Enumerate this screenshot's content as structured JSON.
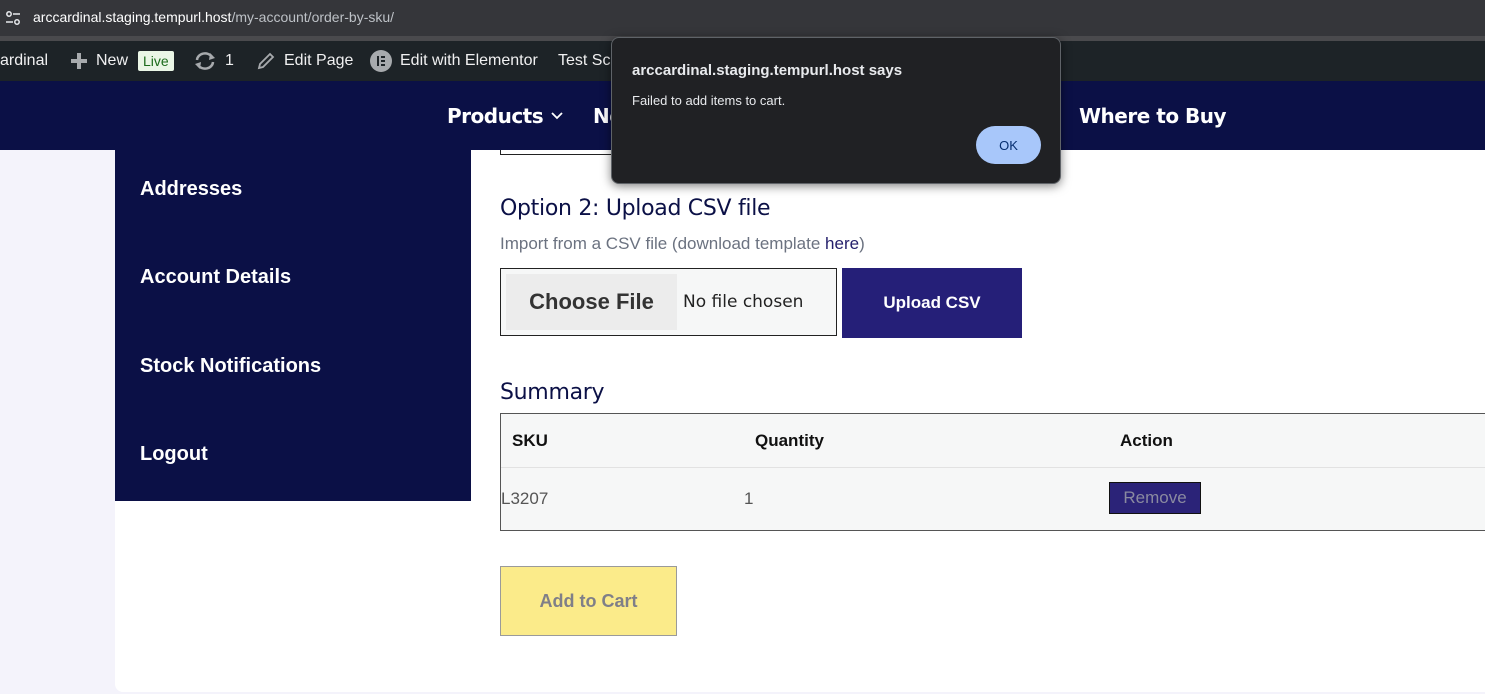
{
  "browser": {
    "url_host": "arccardinal.staging.tempurl.host",
    "url_path": "/my-account/order-by-sku/"
  },
  "admin_bar": {
    "site_name": "ardinal",
    "new_label": "New",
    "live_badge": "Live",
    "updates_count": "1",
    "edit_page": "Edit Page",
    "edit_elementor": "Edit with Elementor",
    "test_label": "Test Sch"
  },
  "site_nav": {
    "items": [
      "Products",
      "No",
      "Where to Buy"
    ]
  },
  "account_menu": {
    "items": [
      "Addresses",
      "Account Details",
      "Stock Notifications",
      "Logout"
    ]
  },
  "upload_section": {
    "heading": "Option 2: Upload CSV file",
    "hint_prefix": "Import from a CSV file (download template ",
    "hint_link": "here",
    "hint_suffix": ")",
    "choose_file": "Choose File",
    "no_file": "No file chosen",
    "upload_button": "Upload CSV"
  },
  "summary": {
    "heading": "Summary",
    "columns": [
      "SKU",
      "Quantity",
      "Action"
    ],
    "rows": [
      {
        "sku": "L3207",
        "quantity": "1",
        "action": "Remove"
      }
    ]
  },
  "add_to_cart": "Add to Cart",
  "dialog": {
    "title": "arccardinal.staging.tempurl.host says",
    "message": "Failed to add items to cart.",
    "ok": "OK"
  },
  "colors": {
    "navy": "#0b1046",
    "button_purple": "#251f78",
    "cart_yellow": "#fbeb8a",
    "dialog_bg": "#202124",
    "ok_blue": "#a8c7fa"
  }
}
